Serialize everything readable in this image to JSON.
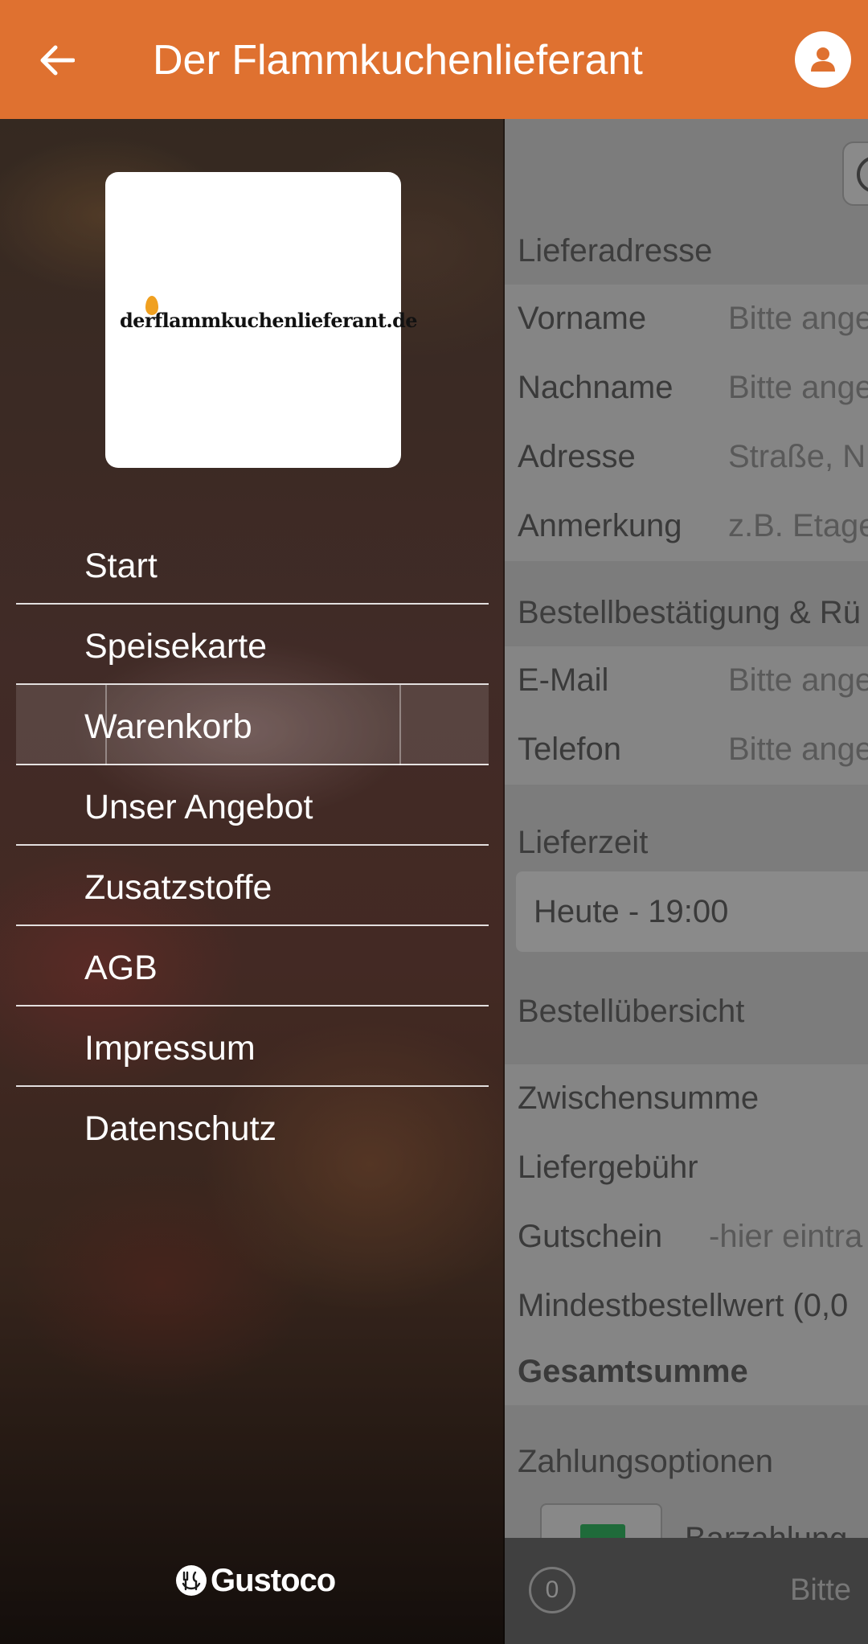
{
  "appbar": {
    "title": "Der Flammkuchenlieferant",
    "back_icon": "arrow-left-icon",
    "user_icon": "user-icon"
  },
  "drawer": {
    "logo_text": "derflammkuchenlieferant.de",
    "menu": [
      {
        "label": "Start"
      },
      {
        "label": "Speisekarte"
      },
      {
        "label": "Warenkorb"
      },
      {
        "label": "Unser Angebot"
      },
      {
        "label": "Zusatzstoffe"
      },
      {
        "label": "AGB"
      },
      {
        "label": "Impressum"
      },
      {
        "label": "Datenschutz"
      }
    ],
    "active_item": "Warenkorb",
    "footer_brand": "Gustoco"
  },
  "checkout": {
    "delivery_address": {
      "section": "Lieferadresse",
      "firstname_label": "Vorname",
      "firstname_placeholder": "Bitte ange",
      "lastname_label": "Nachname",
      "lastname_placeholder": "Bitte ange",
      "address_label": "Adresse",
      "address_placeholder": "Straße, N",
      "note_label": "Anmerkung",
      "note_placeholder": "z.B. Etage"
    },
    "confirmation": {
      "section": "Bestellbestätigung & Rü",
      "email_label": "E-Mail",
      "email_placeholder": "Bitte ange",
      "phone_label": "Telefon",
      "phone_placeholder": "Bitte ange"
    },
    "delivery_time": {
      "section": "Lieferzeit",
      "value": "Heute - 19:00"
    },
    "summary": {
      "section": "Bestellübersicht",
      "subtotal_label": "Zwischensumme",
      "delivery_fee_label": "Liefergebühr",
      "voucher_label": "Gutschein",
      "voucher_placeholder": "-hier eintra",
      "min_order_label": "Mindestbestellwert (0,0",
      "total_label": "Gesamtsumme"
    },
    "payment": {
      "section": "Zahlungsoptionen",
      "cash_label": "Barzahlung"
    }
  },
  "bottombar": {
    "count": "0",
    "hint": "Bitte"
  },
  "colors": {
    "accent": "#DF7130",
    "white": "#FFFFFF"
  }
}
